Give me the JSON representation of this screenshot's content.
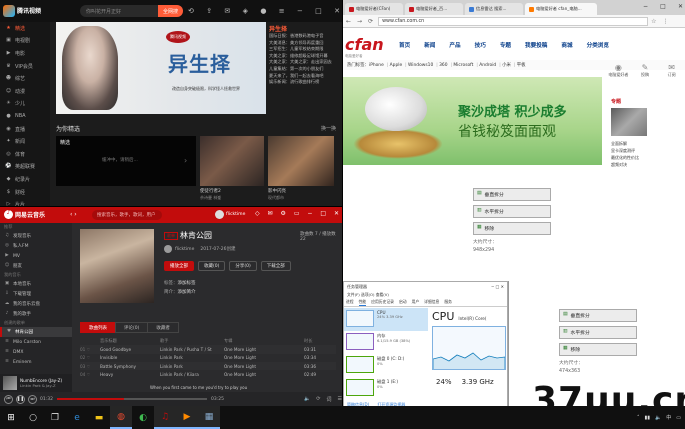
{
  "video_app": {
    "logo": "腾讯视频",
    "search_placeholder": "你叫花开月正好",
    "search_button": "全网搜",
    "sidebar": [
      "精选",
      "电视剧",
      "电影",
      "VIP会员",
      "综艺",
      "动漫",
      "少儿",
      "NBA",
      "直播",
      "新闻",
      "体育",
      "英超联赛",
      "纪录片",
      "财经",
      "片片",
      "生活",
      "游戏",
      "音乐",
      "娱乐"
    ],
    "banner_stamp": "腾讯视频",
    "banner_title": "异生择",
    "banner_subtitle": "改造自身突破极限，科学怪人拯救世界",
    "news_highlight": "异生择",
    "news": [
      "国际日报：香港数码港电子音",
      "大美消息：美方领导再度重回",
      "三军招生：儿童军校结束期限",
      "大美之家：维修超级足球馆开幕",
      "大美之家：大美之家：走出家园去",
      "儿童集结：第一次的小朋友们",
      "夏天来了，我们一起去看海吧",
      "娱乐新闻：流行歌曲排行榜"
    ],
    "section_title": "为你精选",
    "section_more": "换一换",
    "rec_label": "精选",
    "loading_text": "缓冲中，请稍后...",
    "card1_title": "使徒行者2",
    "card1_sub": "佘诗曼 林峯",
    "card2_title": "影中闪亮",
    "card2_sub": "现代都市"
  },
  "music_app": {
    "brand": "网易云音乐",
    "search_placeholder": "搜索音乐，歌手，歌词，用户",
    "user": "flicktime",
    "sidebar_groups": [
      {
        "title": "推荐",
        "items": [
          "发现音乐",
          "私人FM",
          "MV",
          "朋友"
        ]
      },
      {
        "title": "我的音乐",
        "items": [
          "本地音乐",
          "下载管理",
          "我的音乐云盘",
          "我的歌手"
        ]
      },
      {
        "title": "创建的歌单",
        "items": [
          "林肯公园",
          "Milo Carston",
          "DMX",
          "Eminem"
        ]
      }
    ],
    "now_playing": "NumbEncore (Jay-Z)",
    "now_artist": "Linkin Park & Jay-Z",
    "playlist_badge": "歌单",
    "playlist_title": "林肯公园",
    "owner": "flicktime",
    "created": "2017-07-26创建",
    "buttons": [
      "播放全部",
      "收藏(0)",
      "分享(0)",
      "下载全部"
    ],
    "tags_label": "标签：",
    "tags_value": "添加标签",
    "desc_label": "简介：",
    "desc_value": "添加简介",
    "stats": "歌曲数 7 / 播放数 22",
    "tabs": [
      "歌曲列表",
      "评论(0)",
      "收藏者"
    ],
    "columns": [
      "音乐标题",
      "歌手",
      "专辑",
      "时长"
    ],
    "songs": [
      {
        "title": "Good Goodbye",
        "artist": "Linkin Park / Pusha T / St",
        "album": "One More Light",
        "time": "03:31"
      },
      {
        "title": "Invisible",
        "artist": "Linkin Park",
        "album": "One More Light",
        "time": "03:34"
      },
      {
        "title": "Battle Symphony",
        "artist": "Linkin Park",
        "album": "One More Light",
        "time": "03:36"
      },
      {
        "title": "Heavy",
        "artist": "Linkin Park / Kiiara",
        "album": "One More Light",
        "time": "02:49"
      }
    ],
    "lyric": "When you first came to me you'd try to play you",
    "elapsed": "01:32",
    "duration": "03:25",
    "progress_pct": 45
  },
  "browser": {
    "tabs": [
      "电脑爱好者(CFan)",
      "电脑爱好者_百...",
      "信息雷达 搜索...",
      "电脑爱好者 cfan_电脑..."
    ],
    "url": "www.cfan.com.cn",
    "logo": "cfan",
    "logo_sub": "电脑爱好者",
    "menu": [
      "首页",
      "新闻",
      "产品",
      "技巧",
      "专题",
      "我要投稿",
      "商城",
      "分类浏览"
    ],
    "hot_label": "热门标签：",
    "hot_tags": [
      "iPhone",
      "Apple",
      "Windows10",
      "360",
      "Microsoft",
      "Android",
      "小米",
      "平板"
    ],
    "ad_line1": "聚沙成塔 积少成多",
    "ad_line2": "省钱秘笈面面观",
    "right_icons": [
      "电脑爱好者",
      "投稿",
      "订阅"
    ],
    "right_tag": "专题",
    "right_items": [
      "全面拆解",
      "显卡深度测评",
      "最优化的性价比",
      "超频对决"
    ]
  },
  "snap_pane_a": {
    "buttons": [
      "垂直拆分",
      "水平拆分",
      "移除"
    ],
    "size_label": "大约尺寸：",
    "size_value": "948x294"
  },
  "snap_pane_b": {
    "buttons": [
      "垂直拆分",
      "水平拆分",
      "移除"
    ],
    "size_label": "大约尺寸：",
    "size_value": "474x363"
  },
  "task_manager": {
    "title": "任务管理器",
    "menu": "文件(F)  选项(O)  查看(V)",
    "tabs": [
      "进程",
      "性能",
      "应用历史记录",
      "启动",
      "用户",
      "详细信息",
      "服务"
    ],
    "items": [
      {
        "name": "CPU",
        "value": "24% 3.39 GHz"
      },
      {
        "name": "内存",
        "value": "6.1/15.9 GB (38%)"
      },
      {
        "name": "磁盘 0 (C: D:)",
        "value": "0%"
      },
      {
        "name": "磁盘 1 (E:)",
        "value": "0%"
      }
    ],
    "detail_title": "CPU",
    "detail_model": "Intel(R) Core(",
    "utilization": "24%",
    "speed": "3.39 GHz",
    "footer": [
      "简略信息(D)",
      "打开资源监视器"
    ]
  },
  "watermark": "37uu.cn",
  "colors": {
    "video_accent": "#ff5c38",
    "music_red": "#c20c0c",
    "cfan_red": "#c8161d",
    "taskbar": "#101010"
  }
}
